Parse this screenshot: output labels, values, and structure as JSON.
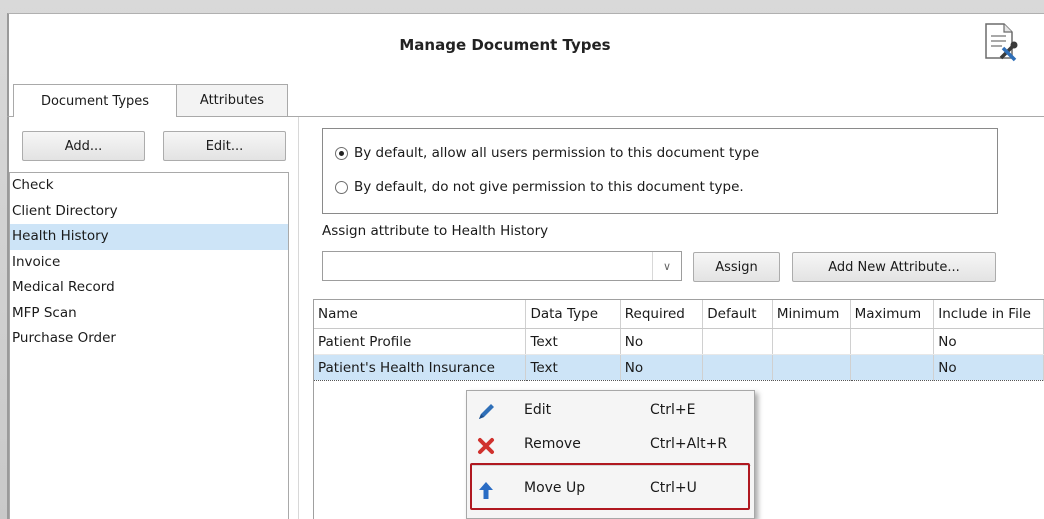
{
  "window": {
    "title": "Manage Document Types"
  },
  "tabs": [
    "Document Types",
    "Attributes"
  ],
  "left_panel": {
    "add_label": "Add...",
    "edit_label": "Edit...",
    "document_types": [
      "Check",
      "Client Directory",
      "Health History",
      "Invoice",
      "Medical Record",
      "MFP Scan",
      "Purchase Order"
    ],
    "selected": "Health History"
  },
  "permissions": {
    "allow_label": "By default, allow all users permission to this document type",
    "deny_label": "By default, do not give permission to this document type.",
    "selected": "allow"
  },
  "assign": {
    "label": "Assign attribute to Health History",
    "combo_value": "",
    "assign_button": "Assign",
    "add_new_button": "Add New Attribute..."
  },
  "attributes_table": {
    "columns": [
      "Name",
      "Data Type",
      "Required",
      "Default",
      "Minimum",
      "Maximum",
      "Include in File"
    ],
    "rows": [
      [
        "Patient Profile",
        "Text",
        "No",
        "",
        "",
        "",
        "No"
      ],
      [
        "Patient's Health Insurance",
        "Text",
        "No",
        "",
        "",
        "",
        "No"
      ]
    ],
    "selected_row": 1
  },
  "context_menu": {
    "items": [
      {
        "label": "Edit",
        "shortcut": "Ctrl+E",
        "icon": "pencil-icon"
      },
      {
        "label": "Remove",
        "shortcut": "Ctrl+Alt+R",
        "icon": "red-x-icon"
      },
      {
        "label": "Move Up",
        "shortcut": "Ctrl+U",
        "icon": "arrow-up-icon"
      }
    ],
    "highlighted_item": "Move Up"
  },
  "colors": {
    "selection": "#cde4f7",
    "highlight_border": "#b01820",
    "remove_icon": "#d0312d",
    "arrow_icon": "#2a6cc4",
    "pencil_icon": "#2f6fb8"
  }
}
